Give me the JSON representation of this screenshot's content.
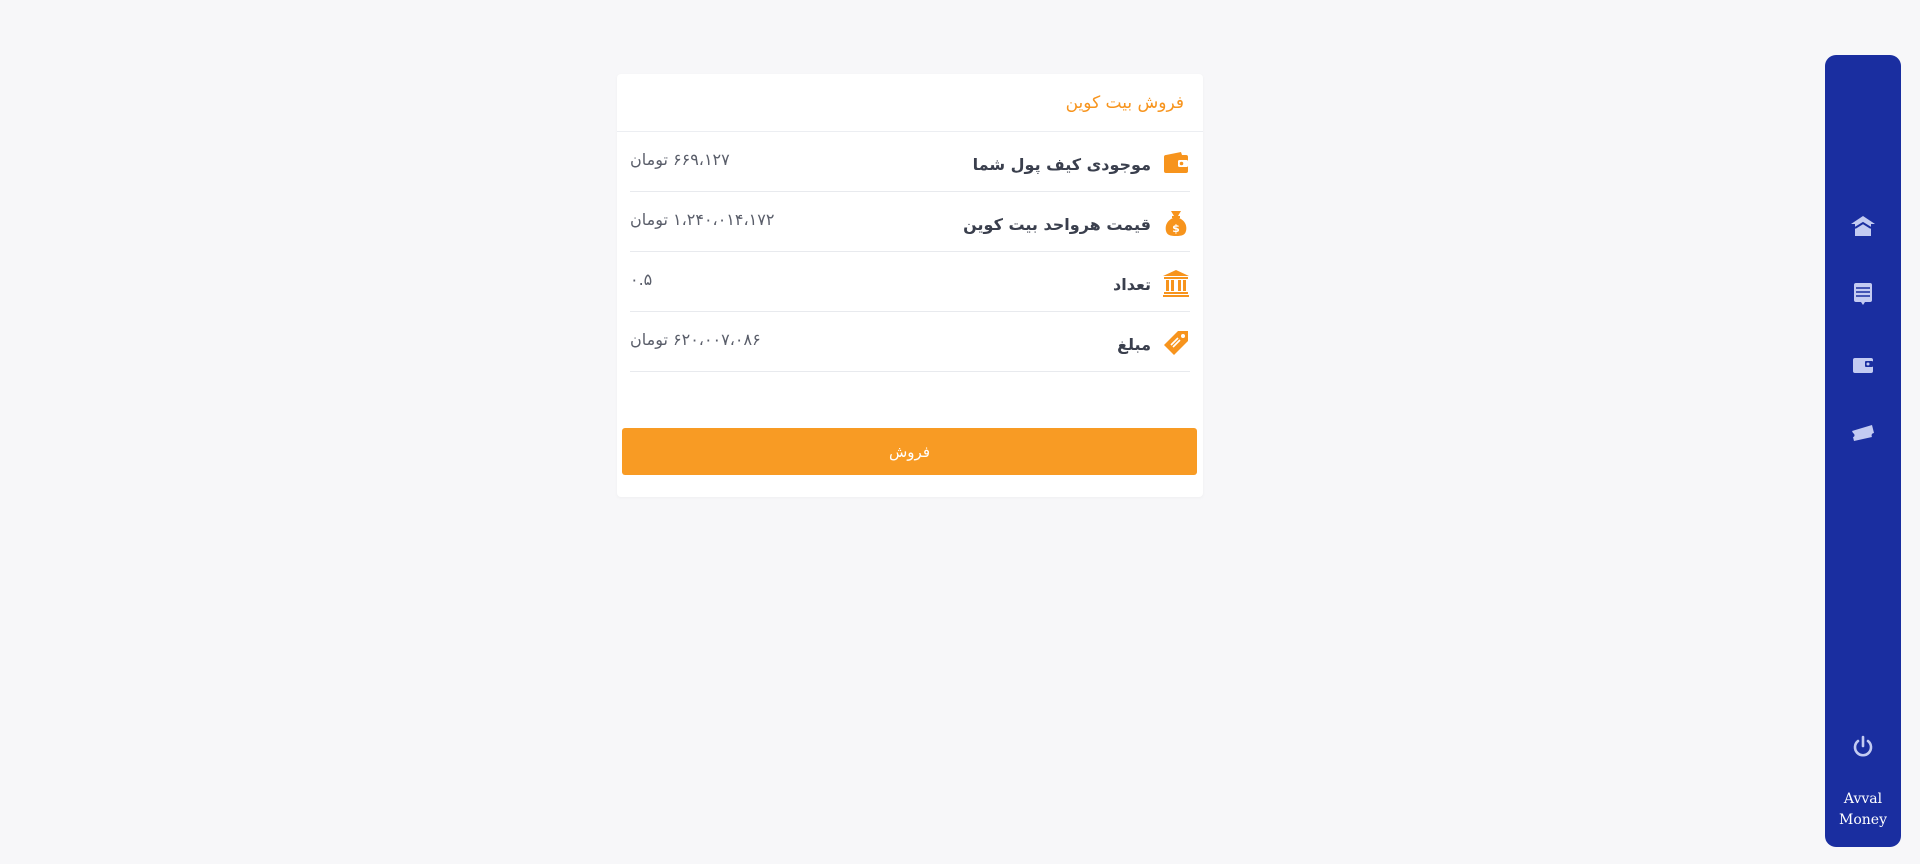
{
  "card": {
    "title": "فروش بیت کوین",
    "rows": [
      {
        "icon": "wallet-icon",
        "label": "موجودی کیف پول شما",
        "value": "۶۶۹،۱۲۷ تومان"
      },
      {
        "icon": "money-bag-icon",
        "label": "قیمت هرواحد بیت کوین",
        "value": "۱،۲۴۰،۰۱۴،۱۷۲ تومان"
      },
      {
        "icon": "bank-icon",
        "label": "تعداد",
        "value": "۰.۵"
      },
      {
        "icon": "price-tag-icon",
        "label": "مبلغ",
        "value": "۶۲۰،۰۰۷،۰۸۶ تومان"
      }
    ],
    "sell_button_label": "فروش"
  },
  "sidebar": {
    "items": [
      {
        "icon": "home-icon"
      },
      {
        "icon": "list-icon"
      },
      {
        "icon": "wallet-icon"
      },
      {
        "icon": "ticket-icon"
      }
    ],
    "logout_icon": "power-icon",
    "brand_line1": "Avval",
    "brand_line2": "Money"
  },
  "colors": {
    "accent": "#f7941d",
    "button": "#f89b24",
    "sidebar": "#1a2ea0",
    "background": "#f7f7f9"
  }
}
